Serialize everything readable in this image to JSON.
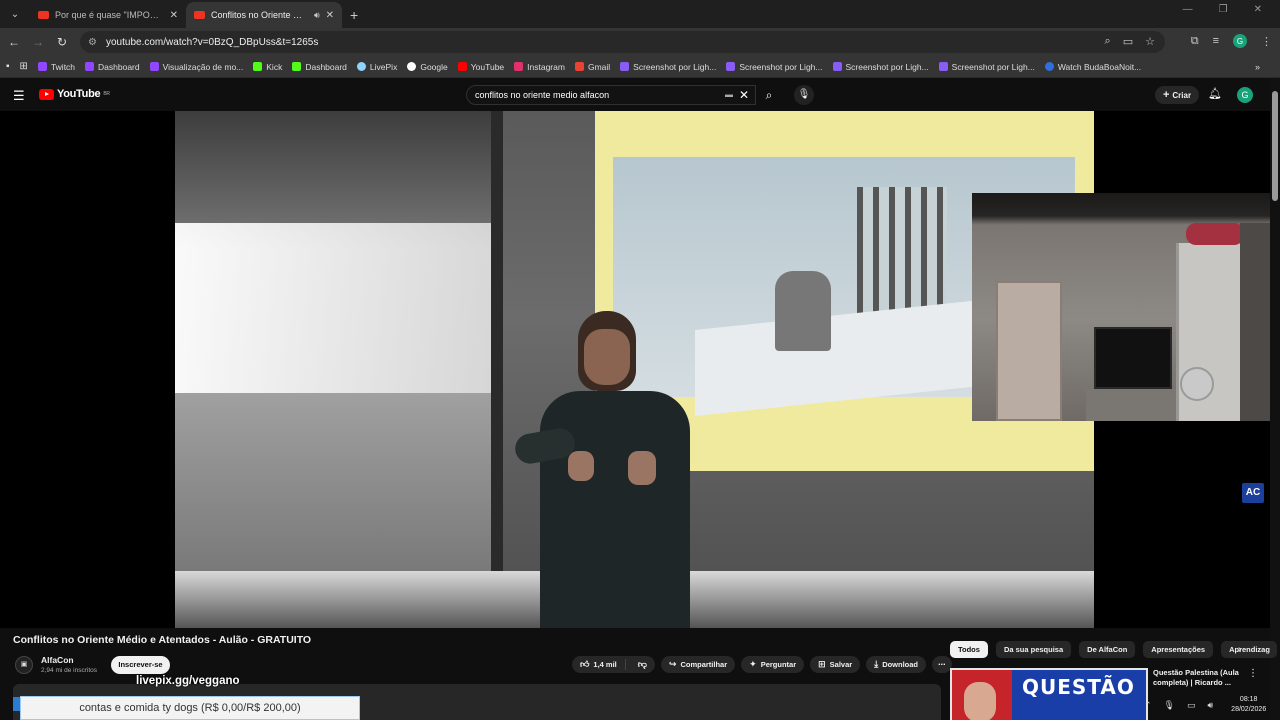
{
  "browser": {
    "tabs": [
      {
        "title": "Por que é quase \"IMPOSSÍVEL\"",
        "active": false
      },
      {
        "title": "Conflitos no Oriente Médio",
        "active": true
      }
    ],
    "url": "youtube.com/watch?v=0BzQ_DBpUss&t=1265s",
    "bookmarks": [
      {
        "label": "Twitch",
        "color": "#9146ff"
      },
      {
        "label": "Dashboard",
        "color": "#9146ff"
      },
      {
        "label": "Visualização de mo...",
        "color": "#9146ff"
      },
      {
        "label": "Kick",
        "color": "#53fc18"
      },
      {
        "label": "Dashboard",
        "color": "#53fc18"
      },
      {
        "label": "LivePix",
        "color": "#8fd3ff"
      },
      {
        "label": "Google",
        "color": "#4285f4"
      },
      {
        "label": "YouTube",
        "color": "#ff0000"
      },
      {
        "label": "Instagram",
        "color": "#e1306c"
      },
      {
        "label": "Gmail",
        "color": "#ea4335"
      },
      {
        "label": "Screenshot por Ligh...",
        "color": "#8a5cf6"
      },
      {
        "label": "Screenshot por Ligh...",
        "color": "#8a5cf6"
      },
      {
        "label": "Screenshot por Ligh...",
        "color": "#8a5cf6"
      },
      {
        "label": "Screenshot por Ligh...",
        "color": "#8a5cf6"
      },
      {
        "label": "Watch BudaBoaNoit...",
        "color": "#2f6fde"
      }
    ]
  },
  "youtube": {
    "logo_text": "YouTube",
    "logo_region": "BR",
    "search_query": "conflitos no oriente medio alfacon",
    "create_label": "Criar",
    "avatar_letter": "G"
  },
  "video": {
    "title": "Conflitos no Oriente Médio e Atentados - Aulão - GRATUITO",
    "channel_name": "AlfaCon",
    "channel_subs": "2,94 mi de inscritos",
    "subscribe_label": "Inscrever-se",
    "likes": "1,4 mil",
    "share_label": "Compartilhar",
    "ask_label": "Perguntar",
    "save_label": "Salvar",
    "download_label": "Download",
    "watermark": "AC"
  },
  "sidebar": {
    "chips": [
      "Todos",
      "Da sua pesquisa",
      "De AlfaCon",
      "Apresentações",
      "Aprendizag"
    ],
    "recommendation": {
      "title": "Questão Palestina (Aula completa) | Ricardo ...",
      "thumb_text": "QUESTÃO"
    }
  },
  "stream_overlay": {
    "link": "livepix.gg/veggano",
    "goal": "contas e comida ty dogs (R$ 0,00/R$ 200,00)"
  },
  "taskbar": {
    "time": "08:18",
    "date": "28/02/2026"
  },
  "colors": {
    "accent_red": "#ff0000",
    "background": "#0f0f0f",
    "green_avatar": "#1aa37a"
  }
}
